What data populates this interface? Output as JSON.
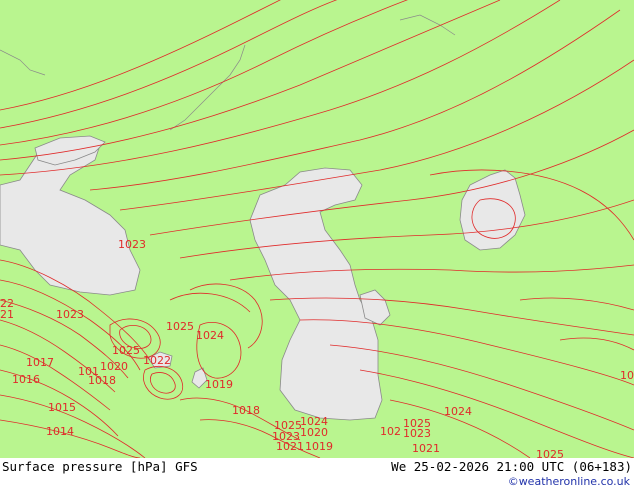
{
  "map": {
    "background_color": "#b9f58f",
    "land_color": "#b9f58f",
    "water_color": "#e8e8e8",
    "isobar_color": "#e02a2a",
    "isobar_labels": [
      {
        "text": "1023"
      },
      {
        "text": "22"
      },
      {
        "text": "21"
      },
      {
        "text": "1023"
      },
      {
        "text": "1024"
      },
      {
        "text": "1025"
      },
      {
        "text": "1025"
      },
      {
        "text": "1022"
      },
      {
        "text": "1017"
      },
      {
        "text": "101"
      },
      {
        "text": "1020"
      },
      {
        "text": "1016"
      },
      {
        "text": "1018"
      },
      {
        "text": "1019"
      },
      {
        "text": "1015"
      },
      {
        "text": "1018"
      },
      {
        "text": "1014"
      },
      {
        "text": "1025"
      },
      {
        "text": "1024"
      },
      {
        "text": "1023"
      },
      {
        "text": "1020"
      },
      {
        "text": "1021"
      },
      {
        "text": "1019"
      },
      {
        "text": "102"
      },
      {
        "text": "1023"
      },
      {
        "text": "1025"
      },
      {
        "text": "1024"
      },
      {
        "text": "1021"
      },
      {
        "text": "1025"
      },
      {
        "text": "10"
      }
    ]
  },
  "footer": {
    "title": "Surface pressure [hPa] GFS",
    "datetime": "We 25-02-2026 21:00 UTC (06+183)",
    "copyright": "©weatheronline.co.uk"
  }
}
